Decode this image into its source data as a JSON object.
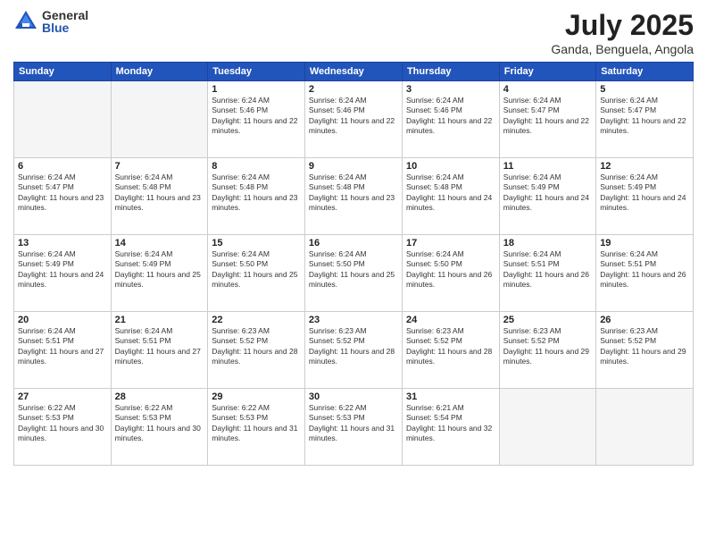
{
  "header": {
    "logo_general": "General",
    "logo_blue": "Blue",
    "month_title": "July 2025",
    "location": "Ganda, Benguela, Angola"
  },
  "weekdays": [
    "Sunday",
    "Monday",
    "Tuesday",
    "Wednesday",
    "Thursday",
    "Friday",
    "Saturday"
  ],
  "weeks": [
    [
      {
        "day": "",
        "info": ""
      },
      {
        "day": "",
        "info": ""
      },
      {
        "day": "1",
        "info": "Sunrise: 6:24 AM\nSunset: 5:46 PM\nDaylight: 11 hours and 22 minutes."
      },
      {
        "day": "2",
        "info": "Sunrise: 6:24 AM\nSunset: 5:46 PM\nDaylight: 11 hours and 22 minutes."
      },
      {
        "day": "3",
        "info": "Sunrise: 6:24 AM\nSunset: 5:46 PM\nDaylight: 11 hours and 22 minutes."
      },
      {
        "day": "4",
        "info": "Sunrise: 6:24 AM\nSunset: 5:47 PM\nDaylight: 11 hours and 22 minutes."
      },
      {
        "day": "5",
        "info": "Sunrise: 6:24 AM\nSunset: 5:47 PM\nDaylight: 11 hours and 22 minutes."
      }
    ],
    [
      {
        "day": "6",
        "info": "Sunrise: 6:24 AM\nSunset: 5:47 PM\nDaylight: 11 hours and 23 minutes."
      },
      {
        "day": "7",
        "info": "Sunrise: 6:24 AM\nSunset: 5:48 PM\nDaylight: 11 hours and 23 minutes."
      },
      {
        "day": "8",
        "info": "Sunrise: 6:24 AM\nSunset: 5:48 PM\nDaylight: 11 hours and 23 minutes."
      },
      {
        "day": "9",
        "info": "Sunrise: 6:24 AM\nSunset: 5:48 PM\nDaylight: 11 hours and 23 minutes."
      },
      {
        "day": "10",
        "info": "Sunrise: 6:24 AM\nSunset: 5:48 PM\nDaylight: 11 hours and 24 minutes."
      },
      {
        "day": "11",
        "info": "Sunrise: 6:24 AM\nSunset: 5:49 PM\nDaylight: 11 hours and 24 minutes."
      },
      {
        "day": "12",
        "info": "Sunrise: 6:24 AM\nSunset: 5:49 PM\nDaylight: 11 hours and 24 minutes."
      }
    ],
    [
      {
        "day": "13",
        "info": "Sunrise: 6:24 AM\nSunset: 5:49 PM\nDaylight: 11 hours and 24 minutes."
      },
      {
        "day": "14",
        "info": "Sunrise: 6:24 AM\nSunset: 5:49 PM\nDaylight: 11 hours and 25 minutes."
      },
      {
        "day": "15",
        "info": "Sunrise: 6:24 AM\nSunset: 5:50 PM\nDaylight: 11 hours and 25 minutes."
      },
      {
        "day": "16",
        "info": "Sunrise: 6:24 AM\nSunset: 5:50 PM\nDaylight: 11 hours and 25 minutes."
      },
      {
        "day": "17",
        "info": "Sunrise: 6:24 AM\nSunset: 5:50 PM\nDaylight: 11 hours and 26 minutes."
      },
      {
        "day": "18",
        "info": "Sunrise: 6:24 AM\nSunset: 5:51 PM\nDaylight: 11 hours and 26 minutes."
      },
      {
        "day": "19",
        "info": "Sunrise: 6:24 AM\nSunset: 5:51 PM\nDaylight: 11 hours and 26 minutes."
      }
    ],
    [
      {
        "day": "20",
        "info": "Sunrise: 6:24 AM\nSunset: 5:51 PM\nDaylight: 11 hours and 27 minutes."
      },
      {
        "day": "21",
        "info": "Sunrise: 6:24 AM\nSunset: 5:51 PM\nDaylight: 11 hours and 27 minutes."
      },
      {
        "day": "22",
        "info": "Sunrise: 6:23 AM\nSunset: 5:52 PM\nDaylight: 11 hours and 28 minutes."
      },
      {
        "day": "23",
        "info": "Sunrise: 6:23 AM\nSunset: 5:52 PM\nDaylight: 11 hours and 28 minutes."
      },
      {
        "day": "24",
        "info": "Sunrise: 6:23 AM\nSunset: 5:52 PM\nDaylight: 11 hours and 28 minutes."
      },
      {
        "day": "25",
        "info": "Sunrise: 6:23 AM\nSunset: 5:52 PM\nDaylight: 11 hours and 29 minutes."
      },
      {
        "day": "26",
        "info": "Sunrise: 6:23 AM\nSunset: 5:52 PM\nDaylight: 11 hours and 29 minutes."
      }
    ],
    [
      {
        "day": "27",
        "info": "Sunrise: 6:22 AM\nSunset: 5:53 PM\nDaylight: 11 hours and 30 minutes."
      },
      {
        "day": "28",
        "info": "Sunrise: 6:22 AM\nSunset: 5:53 PM\nDaylight: 11 hours and 30 minutes."
      },
      {
        "day": "29",
        "info": "Sunrise: 6:22 AM\nSunset: 5:53 PM\nDaylight: 11 hours and 31 minutes."
      },
      {
        "day": "30",
        "info": "Sunrise: 6:22 AM\nSunset: 5:53 PM\nDaylight: 11 hours and 31 minutes."
      },
      {
        "day": "31",
        "info": "Sunrise: 6:21 AM\nSunset: 5:54 PM\nDaylight: 11 hours and 32 minutes."
      },
      {
        "day": "",
        "info": ""
      },
      {
        "day": "",
        "info": ""
      }
    ]
  ]
}
